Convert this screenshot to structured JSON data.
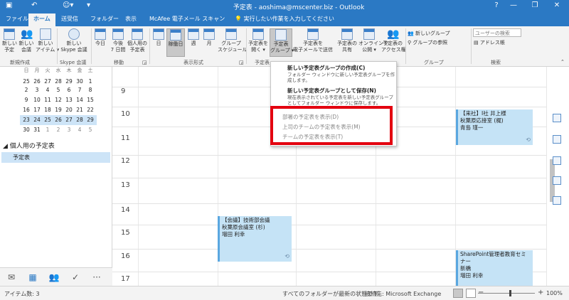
{
  "window": {
    "title": "予定表 - aoshima@mscenter.biz - Outlook",
    "controls": [
      "?",
      "—",
      "❐",
      "✕"
    ]
  },
  "tabs": [
    {
      "label": "ファイル"
    },
    {
      "label": "ホーム"
    },
    {
      "label": "送受信"
    },
    {
      "label": "フォルダー"
    },
    {
      "label": "表示"
    },
    {
      "label": "McAfee 電子メール スキャン"
    },
    {
      "label": "💡 実行したい作業を入力してください"
    }
  ],
  "ribbon": {
    "new_group": {
      "label": "新規作成",
      "new_appt": [
        "新しい",
        "予定"
      ],
      "new_meeting": [
        "新しい",
        "会議"
      ],
      "new_items": [
        "新しい",
        "アイテム ▾"
      ]
    },
    "skype_group": {
      "label": "Skype 会議",
      "button": [
        "新しい",
        "Skype 会議"
      ]
    },
    "goto_group": {
      "label": "移動",
      "today": [
        "今日",
        ""
      ],
      "next7": [
        "今後",
        "7 日間"
      ],
      "personal": [
        "個人用の",
        "予定表"
      ]
    },
    "arrange_group": {
      "label": "表示形式",
      "day": "日",
      "workweek": "稼働日",
      "week": "週",
      "month": "月",
      "schedule": [
        "グループ",
        "スケジュール"
      ]
    },
    "manage_group": {
      "label": "予定表",
      "open": [
        "予定表を",
        "開く ▾"
      ],
      "groups": [
        "予定表",
        "グループ ▾"
      ]
    },
    "share_group": {
      "email": [
        "予定表を",
        "電子メールで送信"
      ],
      "share": [
        "予定表の",
        "共有"
      ],
      "publish": [
        "オンラインで",
        "公開 ▾"
      ],
      "perm": [
        "予定表の",
        "アクセス権"
      ]
    },
    "group_group": {
      "label": "グループ",
      "new_group": "新しいグループ",
      "browse": "グループの参照"
    },
    "find_group": {
      "label": "検索",
      "search_placeholder": "ユーザーの検索",
      "addressbook": "アドレス帳"
    }
  },
  "minical": {
    "day_headers": [
      "日",
      "月",
      "火",
      "水",
      "木",
      "金",
      "土"
    ],
    "rows": [
      [
        {
          "d": "25",
          "dim": false
        },
        {
          "d": "26",
          "dim": false
        },
        {
          "d": "27",
          "dim": false
        },
        {
          "d": "28",
          "dim": false
        },
        {
          "d": "29",
          "dim": false
        },
        {
          "d": "30",
          "dim": false
        },
        {
          "d": "1",
          "dim": false
        }
      ],
      [
        {
          "d": "2",
          "dim": false
        },
        {
          "d": "3",
          "dim": false
        },
        {
          "d": "4",
          "dim": false
        },
        {
          "d": "5",
          "dim": false
        },
        {
          "d": "6",
          "dim": false
        },
        {
          "d": "7",
          "dim": false
        },
        {
          "d": "8",
          "dim": false
        }
      ],
      [
        {
          "d": "9",
          "dim": false
        },
        {
          "d": "10",
          "dim": false
        },
        {
          "d": "11",
          "dim": false
        },
        {
          "d": "12",
          "dim": false
        },
        {
          "d": "13",
          "dim": false
        },
        {
          "d": "14",
          "dim": false
        },
        {
          "d": "15",
          "dim": false
        }
      ],
      [
        {
          "d": "16",
          "dim": false
        },
        {
          "d": "17",
          "dim": false
        },
        {
          "d": "18",
          "dim": false
        },
        {
          "d": "19",
          "dim": false
        },
        {
          "d": "20",
          "dim": false
        },
        {
          "d": "21",
          "dim": false
        },
        {
          "d": "22",
          "dim": false
        }
      ],
      [
        {
          "d": "23",
          "dim": false
        },
        {
          "d": "24",
          "dim": false
        },
        {
          "d": "25",
          "dim": false
        },
        {
          "d": "26",
          "dim": false
        },
        {
          "d": "27",
          "dim": false
        },
        {
          "d": "28",
          "dim": false
        },
        {
          "d": "29",
          "dim": false
        }
      ],
      [
        {
          "d": "30",
          "dim": false
        },
        {
          "d": "31",
          "dim": false
        },
        {
          "d": "1",
          "dim": true
        },
        {
          "d": "2",
          "dim": true
        },
        {
          "d": "3",
          "dim": true
        },
        {
          "d": "4",
          "dim": true
        },
        {
          "d": "5",
          "dim": true
        }
      ]
    ]
  },
  "my_calendars": {
    "header": "◢ 個人用の予定表",
    "items": [
      "予定表"
    ]
  },
  "nav_icons": [
    "✉",
    "▦",
    "👥",
    "✓",
    "···"
  ],
  "hours": [
    "9",
    "10",
    "11",
    "12",
    "13",
    "14",
    "15",
    "16",
    "17"
  ],
  "events": [
    {
      "lines": [
        "【来社】I社 井上様",
        "秋葉原応接室 (梶)",
        "青島 瑾一"
      ]
    },
    {
      "lines": [
        "【会議】技術部会議",
        "秋葉原会議室 (杉)",
        "増田 利幸"
      ]
    },
    {
      "lines": [
        "SharePoint管理者教育セミ",
        "ナー",
        "新橋",
        "増田 利幸"
      ]
    }
  ],
  "recurrence_icon": "⟲",
  "dropdown": {
    "items": [
      {
        "title": "新しい予定表グループの作成(C)",
        "desc": "フォルダー ウィンドウに新しい予定表グループを作成します。"
      },
      {
        "title": "新しい予定表グループとして保存(N)",
        "desc": "現在表示されている予定表を新しい予定表グループとしてフォルダー ウィンドウに保存します。"
      }
    ],
    "disabled": [
      "部署の予定表を表示(D)",
      "上司のチームの予定表を表示(M)",
      "チームの予定表を表示(T)"
    ]
  },
  "status": {
    "items": "アイテム数: 3",
    "sync": "すべてのフォルダーが最新の状態です。",
    "conn": "接続先: Microsoft Exchange",
    "zoom": "100%",
    "minus": "−",
    "plus": "+"
  },
  "colors": {
    "accent": "#2b79c4",
    "highlight": "#e3000f",
    "event": "#c5e3f6"
  }
}
